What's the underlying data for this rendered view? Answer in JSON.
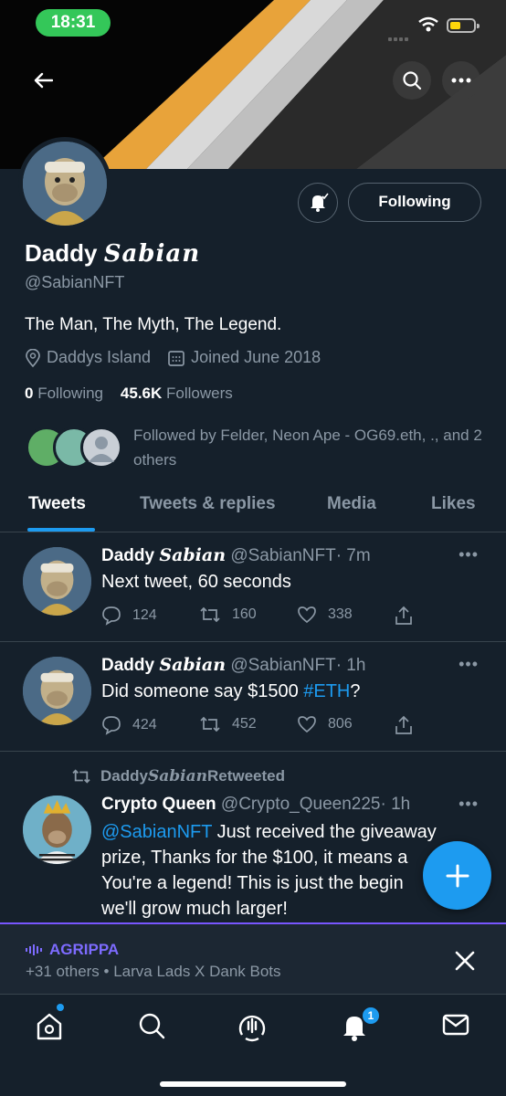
{
  "status_bar": {
    "time": "18:31"
  },
  "profile": {
    "display_name_plain": "Daddy ",
    "display_name_styled": "Sabian",
    "handle": "@SabianNFT",
    "bio": "The Man, The Myth, The Legend.",
    "location": "Daddys Island",
    "joined": "Joined June 2018",
    "following_count": "0",
    "following_label": "Following",
    "followers_count": "45.6K",
    "followers_label": "Followers",
    "followed_by": "Followed by Felder, Neon Ape - OG69.eth, ., and 2 others",
    "follow_button": "Following"
  },
  "tabs": [
    {
      "label": "Tweets",
      "active": true
    },
    {
      "label": "Tweets & replies",
      "active": false
    },
    {
      "label": "Media",
      "active": false
    },
    {
      "label": "Likes",
      "active": false
    }
  ],
  "tweets": [
    {
      "name_plain": "Daddy ",
      "name_styled": "Sabian",
      "handle": "@SabianNFT",
      "time": "· 7m",
      "text": "Next tweet, 60 seconds",
      "replies": "124",
      "retweets": "160",
      "likes": "338"
    },
    {
      "name_plain": "Daddy ",
      "name_styled": "Sabian",
      "handle": "@SabianNFT",
      "time": "· 1h",
      "text_before": "Did someone say $1500 ",
      "hashtag": "#ETH",
      "text_after": "?",
      "replies": "424",
      "retweets": "452",
      "likes": "806"
    },
    {
      "retweet_label_plain": "Daddy ",
      "retweet_label_styled": "Sabian",
      "retweet_label_suffix": " Retweeted",
      "name": "Crypto Queen",
      "handle": "@Crypto_Queen225",
      "time": "· 1h",
      "mention": "@SabianNFT",
      "text_line1": " Just received the giveaway",
      "text_line2": "prize, Thanks for the $100, it means a",
      "text_line3": "You're a legend! This is just the begin",
      "text_line4": "we'll grow much larger!"
    }
  ],
  "spaces": {
    "host": "AGRIPPA",
    "subtitle": "+31 others • Larva Lads X Dank Bots"
  },
  "bottom_nav": {
    "notifications_badge": "1"
  },
  "colors": {
    "background": "#15202b",
    "accent": "#1d9bf0",
    "muted": "#8b98a5",
    "divider": "#38444d",
    "spaces_purple": "#7856ff"
  },
  "more_glyph": "•••"
}
